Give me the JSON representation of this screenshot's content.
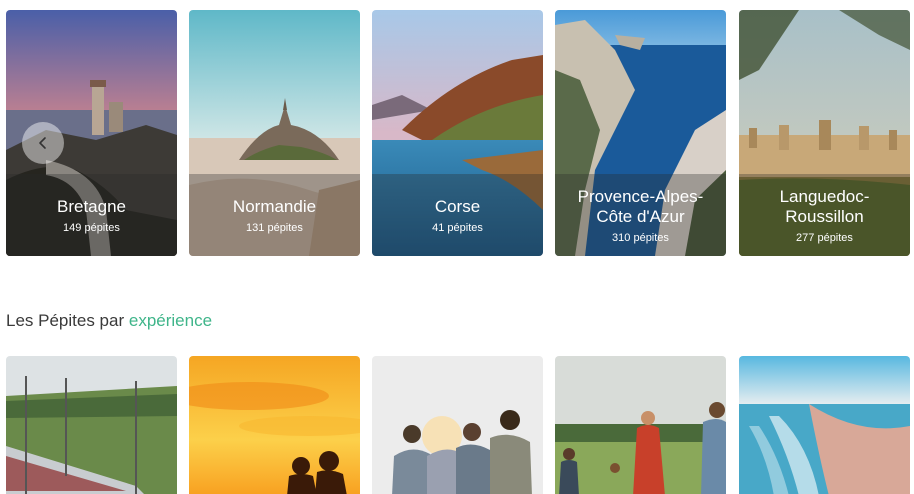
{
  "regions": [
    {
      "name": "Bretagne",
      "count": "149 pépites"
    },
    {
      "name": "Normandie",
      "count": "131 pépites"
    },
    {
      "name": "Corse",
      "count": "41 pépites"
    },
    {
      "name": "Provence-Alpes-Côte d'Azur",
      "count": "310 pépites"
    },
    {
      "name": "Languedoc-Roussillon",
      "count": "277 pépites"
    }
  ],
  "experience_section": {
    "title_prefix": "Les Pépites par ",
    "title_accent": "expérience"
  },
  "experiences": [
    {
      "icon": "train-photo"
    },
    {
      "icon": "sunset-couple-photo"
    },
    {
      "icon": "friends-group-photo"
    },
    {
      "icon": "family-field-photo"
    },
    {
      "icon": "beach-aerial-photo"
    }
  ],
  "colors": {
    "accent": "#3fb58a"
  }
}
